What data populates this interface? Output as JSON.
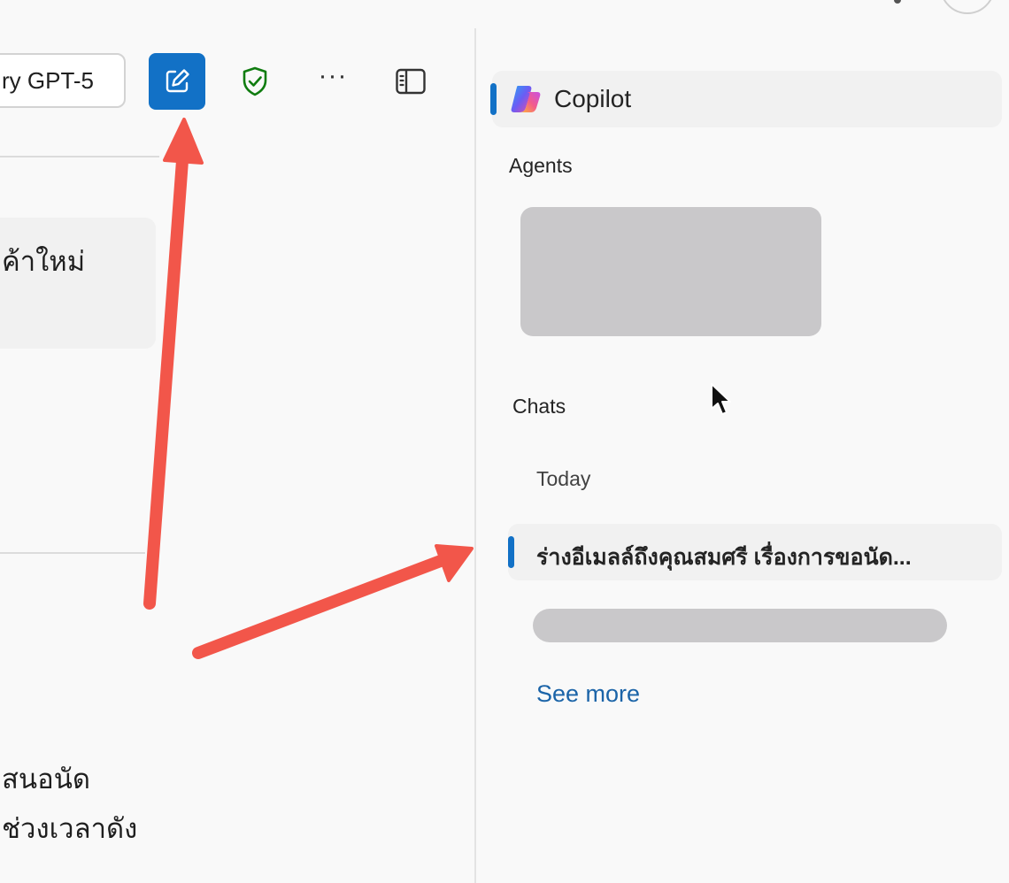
{
  "toolbar": {
    "try_model_label": "ry GPT-5",
    "new_chat_icon": "compose-icon",
    "shield_icon": "shield-check-icon",
    "more_label": "···",
    "sidebar_toggle_icon": "sidebar-toggle-icon"
  },
  "main": {
    "suggestion_text": "ค้าใหม่",
    "body_lines": [
      "สนอนัด",
      "ช่วงเวลาดัง"
    ]
  },
  "sidebar": {
    "copilot_label": "Copilot",
    "copilot_icon": "copilot-logo-icon",
    "agents_heading": "Agents",
    "chats_heading": "Chats",
    "group_today": "Today",
    "chats": [
      {
        "title": "ร่างอีเมลล์ถึงคุณสมศรี เรื่องการขอนัด..."
      }
    ],
    "see_more_label": "See more"
  },
  "colors": {
    "accent": "#1271c6",
    "link": "#1b64a8",
    "annotation_arrow": "#f2564a",
    "shield": "#107c10",
    "placeholder": "#c9c8ca"
  }
}
